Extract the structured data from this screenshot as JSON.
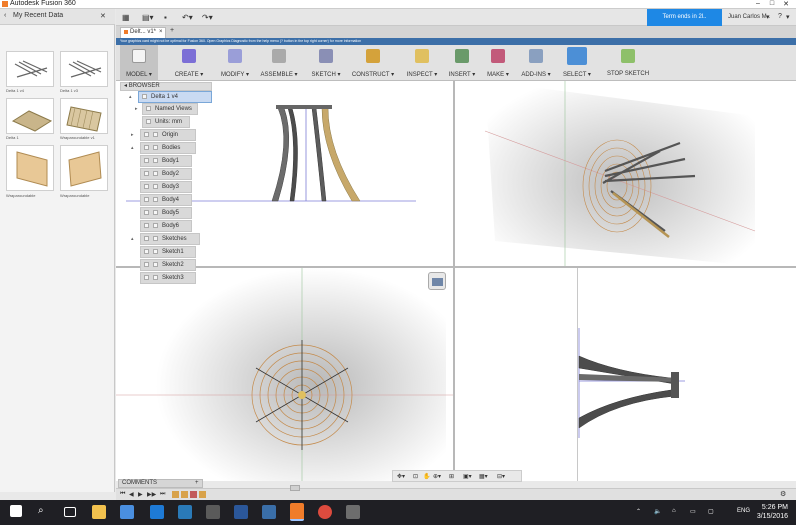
{
  "window": {
    "title": "Autodesk Fusion 360"
  },
  "datapanel": {
    "title": "My Recent Data",
    "items": [
      {
        "label": "Delta 1 v4"
      },
      {
        "label": "Delta 1 v3"
      },
      {
        "label": "Delta 1"
      },
      {
        "label": "Wraparoundable v1"
      },
      {
        "label": "Wraparoundable"
      },
      {
        "label": "Wraparoundable"
      }
    ]
  },
  "header": {
    "trial": "Term ends in 2l..",
    "user": "Juan Carlos M..",
    "help": "?"
  },
  "tab": {
    "label": "Delt... v1*",
    "close": "×",
    "add": "+"
  },
  "banner": "Your graphics card might not be optimal for Fusion 360. Open Graphics Diagnostic from the help menu (? button in the top right corner) for more information",
  "ribbon": {
    "workspace": "MODEL ▾",
    "menus": [
      "CREATE ▾",
      "MODIFY ▾",
      "ASSEMBLE ▾",
      "SKETCH ▾",
      "CONSTRUCT ▾",
      "INSPECT ▾",
      "INSERT ▾",
      "MAKE ▾",
      "ADD-INS ▾",
      "SELECT ▾",
      "STOP SKETCH"
    ]
  },
  "browser": {
    "title": "BROWSER",
    "root": "Delta 1 v4",
    "items": [
      "Named Views",
      "Units: mm",
      "Origin",
      "Bodies",
      "Body1",
      "Body2",
      "Body3",
      "Body4",
      "Body5",
      "Body6",
      "Sketches",
      "Sketch1",
      "Sketch2",
      "Sketch3"
    ]
  },
  "comments": "COMMENTS",
  "taskbar": {
    "lang": "ENG",
    "time": "5:26 PM",
    "date": "3/15/2016"
  },
  "colors": {
    "accent": "#1e88e5",
    "model_stroke": "#8c7a4a",
    "banner": "#3c6fa8",
    "taskbar": "#1f1f24"
  }
}
